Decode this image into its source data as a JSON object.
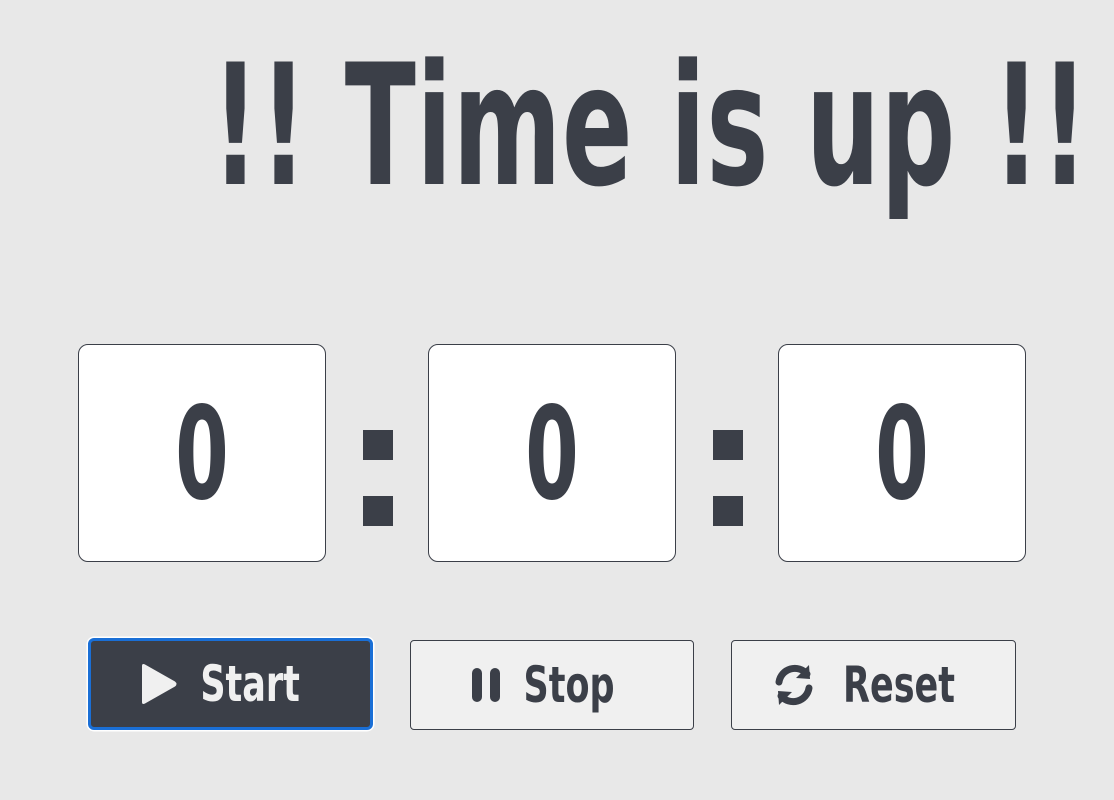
{
  "header": {
    "title": "!! Time is up !!"
  },
  "timer": {
    "hours": "0",
    "minutes": "0",
    "seconds": "0",
    "separator": ":"
  },
  "controls": {
    "start_label": "Start",
    "start_icon": "play-icon",
    "stop_label": "Stop",
    "stop_icon": "pause-icon",
    "reset_label": "Reset",
    "reset_icon": "refresh-icon"
  },
  "colors": {
    "background": "#e8e8e8",
    "foreground": "#3b3f48",
    "focus_ring": "#1a6fd6",
    "box_fill": "#ffffff"
  }
}
